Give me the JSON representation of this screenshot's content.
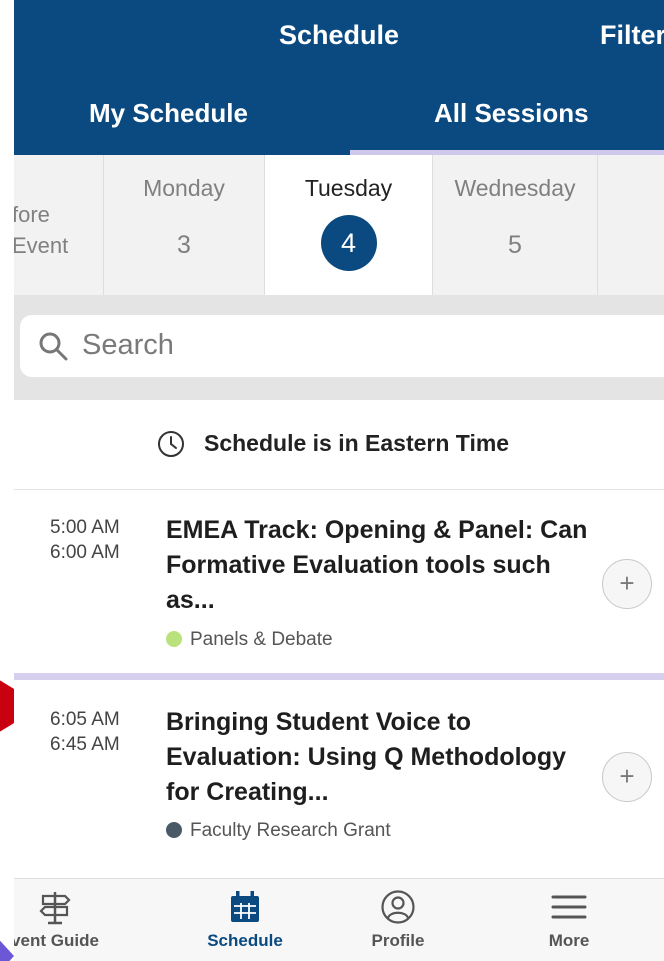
{
  "header": {
    "title": "Schedule",
    "filter_label": "Filter",
    "tabs": {
      "my_schedule": "My Schedule",
      "all_sessions": "All Sessions"
    }
  },
  "days": [
    {
      "name": "fore\nEvent",
      "number": ""
    },
    {
      "name": "Monday",
      "number": "3"
    },
    {
      "name": "Tuesday",
      "number": "4"
    },
    {
      "name": "Wednesday",
      "number": "5"
    }
  ],
  "search": {
    "placeholder": "Search"
  },
  "timezone": {
    "text": "Schedule is in Eastern Time"
  },
  "sessions": [
    {
      "start": "5:00 AM",
      "end": "6:00 AM",
      "title": "EMEA Track: Opening & Panel: Can Formative Evaluation tools such as...",
      "tag": "Panels & Debate",
      "tag_color": "#b9e27d"
    },
    {
      "start": "6:05 AM",
      "end": "6:45 AM",
      "title": "Bringing Student Voice to Evaluation: Using Q Methodology for Creating...",
      "tag": "Faculty Research Grant",
      "tag_color": "#4a5968"
    }
  ],
  "tabbar": {
    "items": [
      {
        "label": "vent Guide",
        "icon": "signpost-icon"
      },
      {
        "label": "Schedule",
        "icon": "calendar-icon"
      },
      {
        "label": "Profile",
        "icon": "profile-icon"
      },
      {
        "label": "More",
        "icon": "menu-icon"
      }
    ]
  },
  "colors": {
    "brand": "#0a4a80",
    "accent": "#cfc7ec"
  }
}
